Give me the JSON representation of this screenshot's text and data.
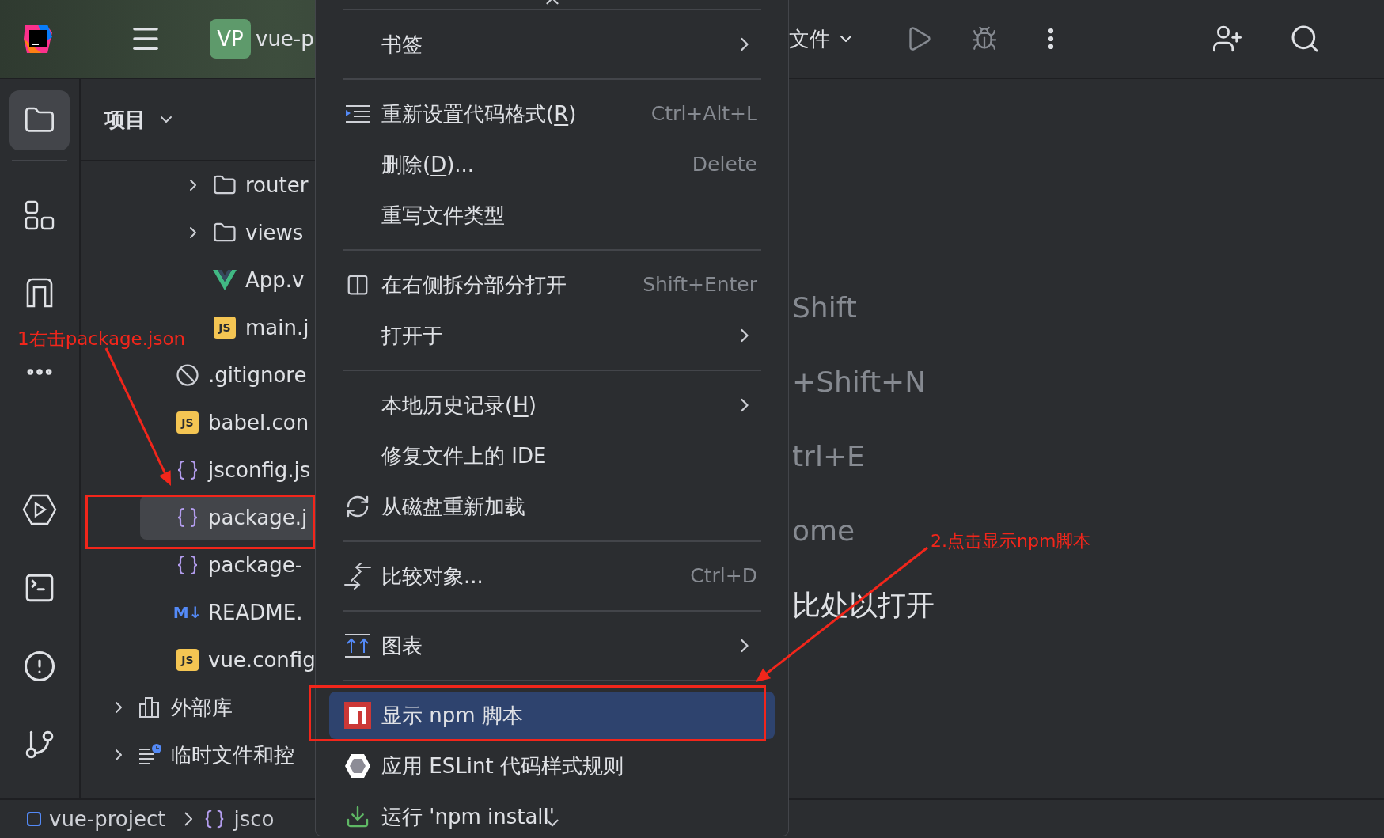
{
  "top_bar": {
    "project_badge": "VP",
    "project_name": "vue-p",
    "file_menu": "文件"
  },
  "project_panel": {
    "title": "项目",
    "tree": [
      {
        "children": [
          {
            "children": [
              {
                "kind": "folder",
                "label": "router",
                "expanded": false
              },
              {
                "kind": "folder",
                "label": "views",
                "expanded": false
              },
              {
                "kind": "vue",
                "label": "App.v"
              },
              {
                "kind": "js",
                "badge": "JS",
                "label": "main.j"
              }
            ]
          },
          {
            "kind": "ignore",
            "label": ".gitignore"
          },
          {
            "kind": "js",
            "badge": "JS",
            "label": "babel.con"
          },
          {
            "kind": "json",
            "label": "jsconfig.js"
          },
          {
            "kind": "json",
            "label": "package.j",
            "selected": true
          },
          {
            "kind": "json",
            "label": "package-"
          },
          {
            "kind": "md",
            "badge": "M↓",
            "label": "README."
          },
          {
            "kind": "js",
            "badge": "JS",
            "label": "vue.config"
          }
        ]
      },
      {
        "kind": "library",
        "label": "外部库",
        "expanded": false
      },
      {
        "kind": "scratch",
        "label": "临时文件和控",
        "expanded": false
      }
    ]
  },
  "context_menu": {
    "items": [
      {
        "kind": "separator"
      },
      {
        "kind": "item",
        "label": "书签",
        "submenu": true,
        "selected": false
      },
      {
        "kind": "separator"
      },
      {
        "kind": "item",
        "label": "重新设置代码格式(",
        "mnemonic": "R",
        "label_after": ")",
        "shortcut": "Ctrl+Alt+L",
        "submenu": false,
        "selected": false
      },
      {
        "kind": "item",
        "label": "删除(",
        "mnemonic": "D",
        "label_after": ")...",
        "shortcut": "Delete",
        "submenu": false,
        "selected": false
      },
      {
        "kind": "item",
        "label": "重写文件类型",
        "submenu": false,
        "selected": false
      },
      {
        "kind": "separator"
      },
      {
        "kind": "item",
        "label": "在右侧拆分部分打开",
        "shortcut": "Shift+Enter",
        "submenu": false,
        "selected": false
      },
      {
        "kind": "item",
        "label": "打开于",
        "submenu": true,
        "selected": false
      },
      {
        "kind": "separator"
      },
      {
        "kind": "item",
        "label": "本地历史记录(",
        "mnemonic": "H",
        "label_after": ")",
        "submenu": true,
        "selected": false
      },
      {
        "kind": "item",
        "label": "修复文件上的 IDE",
        "submenu": false,
        "selected": false
      },
      {
        "kind": "item",
        "label": "从磁盘重新加载",
        "submenu": false,
        "selected": false
      },
      {
        "kind": "separator"
      },
      {
        "kind": "item",
        "label": "比较对象...",
        "shortcut": "Ctrl+D",
        "submenu": false,
        "selected": false
      },
      {
        "kind": "separator"
      },
      {
        "kind": "item",
        "label": "图表",
        "submenu": true,
        "selected": false
      },
      {
        "kind": "separator"
      },
      {
        "kind": "item",
        "label": "显示 npm 脚本",
        "submenu": false,
        "selected": true
      },
      {
        "kind": "item",
        "label": "应用 ESLint 代码样式规则",
        "submenu": false,
        "selected": false
      },
      {
        "kind": "item",
        "label": "运行 'npm install'",
        "submenu": false,
        "selected": false
      }
    ]
  },
  "editor_hints": [
    {
      "kind": "shortcut",
      "text": "Shift"
    },
    {
      "kind": "shortcut",
      "text": "+Shift+N"
    },
    {
      "kind": "shortcut",
      "text": "trl+E"
    },
    {
      "kind": "shortcut",
      "text": "ome"
    },
    {
      "kind": "text",
      "text": "比处以打开"
    }
  ],
  "status_bar": {
    "project": "vue-project",
    "file": "jsco"
  },
  "annotations": [
    {
      "text": "1右击package.json"
    },
    {
      "text": "2.点击显示npm脚本"
    }
  ]
}
